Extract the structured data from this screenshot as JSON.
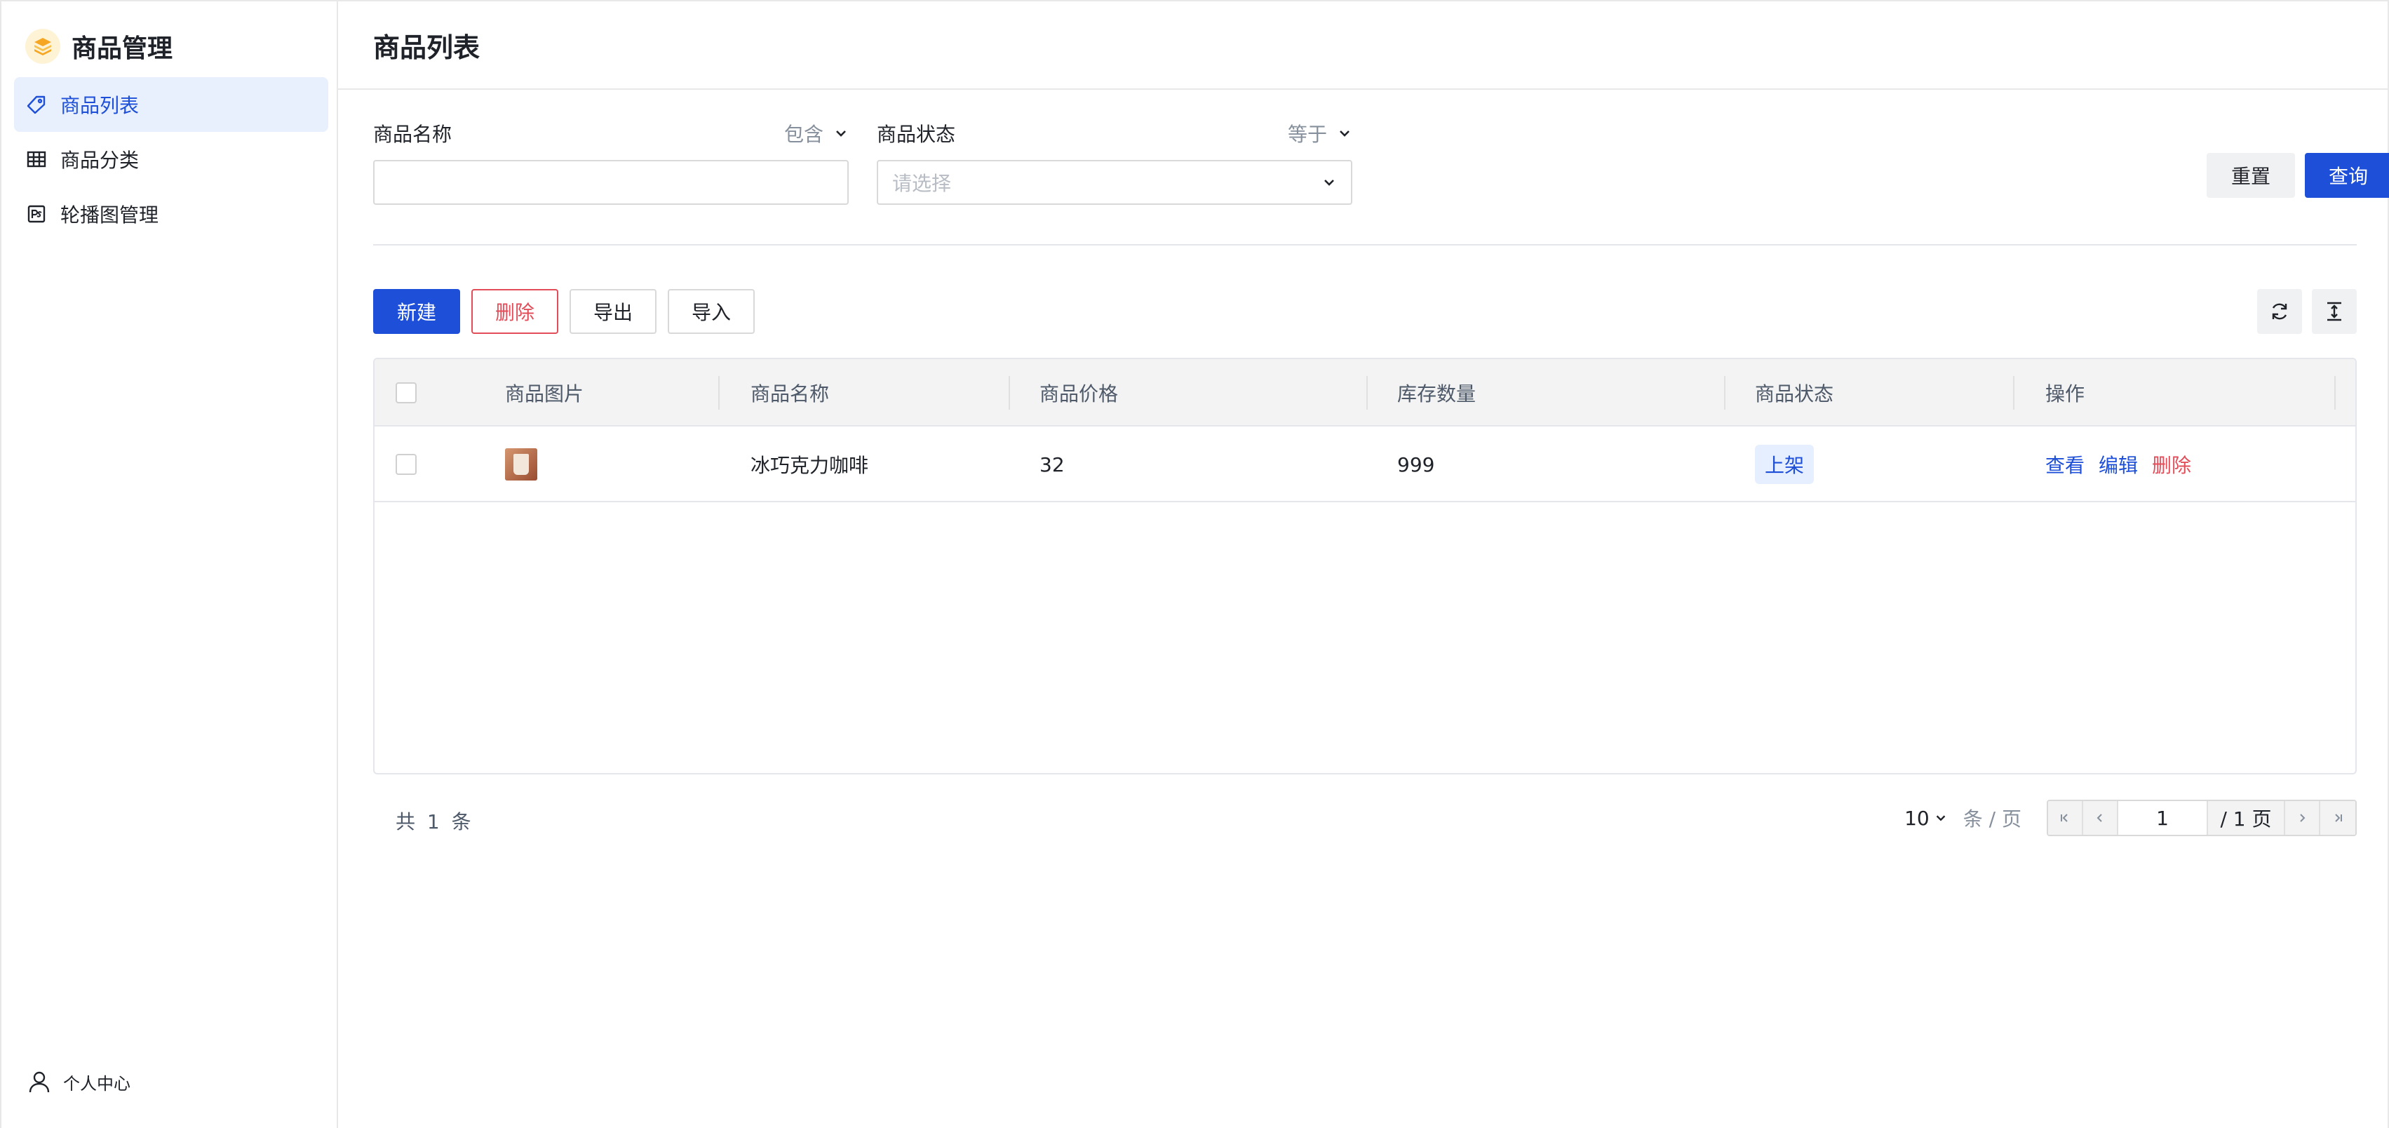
{
  "app": {
    "brand_title": "商品管理",
    "brand_icon": "stack-logo-icon"
  },
  "sidebar": {
    "items": [
      {
        "label": "商品列表",
        "icon": "tag-icon",
        "active": true
      },
      {
        "label": "商品分类",
        "icon": "grid-icon",
        "active": false
      },
      {
        "label": "轮播图管理",
        "icon": "ps-image-icon",
        "active": false
      }
    ],
    "profile_label": "个人中心"
  },
  "page": {
    "title": "商品列表"
  },
  "filters": {
    "name": {
      "label": "商品名称",
      "operator": "包含",
      "value": ""
    },
    "status": {
      "label": "商品状态",
      "operator": "等于",
      "placeholder": "请选择"
    },
    "reset_label": "重置",
    "query_label": "查询"
  },
  "toolbar": {
    "new_label": "新建",
    "delete_label": "删除",
    "export_label": "导出",
    "import_label": "导入"
  },
  "table": {
    "columns": [
      "商品图片",
      "商品名称",
      "商品价格",
      "库存数量",
      "商品状态",
      "操作"
    ],
    "rows": [
      {
        "name": "冰巧克力咖啡",
        "price": "32",
        "stock": "999",
        "status": "上架",
        "actions": {
          "view": "查看",
          "edit": "编辑",
          "delete": "删除"
        }
      }
    ]
  },
  "pagination": {
    "total_text": "共 1 条",
    "page_size": "10",
    "per_page_label": "条 / 页",
    "current_page": "1",
    "total_pages_text": "/ 1 页"
  },
  "colors": {
    "primary": "#1d4fd8",
    "danger": "#e34d59",
    "active_bg": "#e8f0fe"
  }
}
